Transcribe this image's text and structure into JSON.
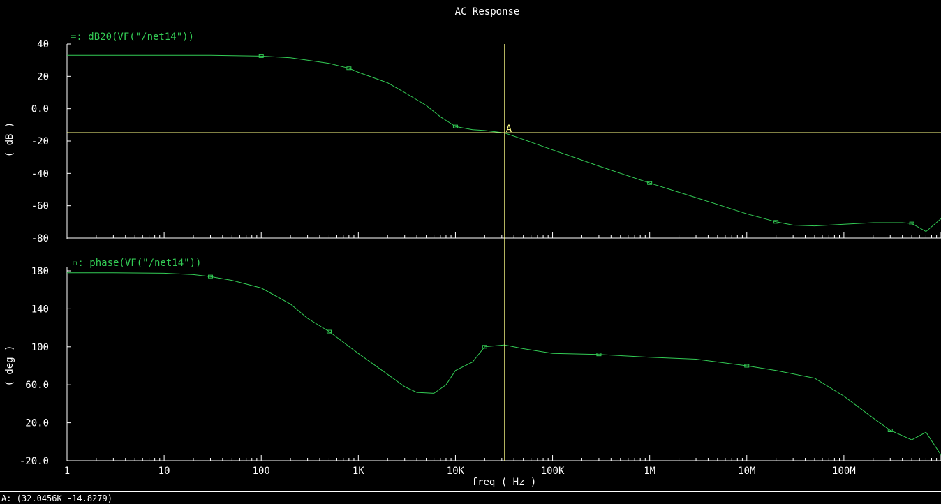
{
  "window": {
    "title": "AC Response"
  },
  "colors": {
    "background": "#000000",
    "trace": "#33cc55",
    "marker": "#ffff88",
    "text": "#ffffff",
    "axis": "#ffffff"
  },
  "status": {
    "text": "A: (32.0456K -14.8279)"
  },
  "marker": {
    "label": "A",
    "x": 32045.6,
    "y": -14.8279
  },
  "chart_data": [
    {
      "type": "line",
      "legend": "=: dB20(VF(\"/net14\"))",
      "ylabel": "( dB )",
      "xscale": "log",
      "xlim": [
        1,
        1000000000
      ],
      "ylim": [
        -80,
        40
      ],
      "yticks": [
        40,
        20,
        0,
        -20,
        -40,
        -60,
        -80
      ],
      "ytick_labels": [
        "40",
        "20",
        "0.0",
        "-20",
        "-40",
        "-60",
        "-80"
      ],
      "series": [
        {
          "x": [
            1,
            3,
            10,
            30,
            100,
            200,
            300,
            500,
            800,
            1000,
            2000,
            3000,
            5000,
            7000,
            10000,
            15000,
            20000,
            32000,
            50000,
            100000,
            300000,
            1000000,
            3000000,
            10000000,
            20000000,
            30000000,
            50000000,
            100000000,
            200000000,
            300000000,
            400000000,
            500000000,
            700000000,
            1000000000
          ],
          "y": [
            33,
            33,
            33,
            33,
            32.5,
            31.5,
            30,
            28,
            25,
            22.5,
            16,
            10,
            2,
            -5,
            -11,
            -13,
            -13.5,
            -15,
            -19,
            -25.5,
            -35.5,
            -46,
            -55,
            -65,
            -70,
            -72,
            -72.5,
            -71.5,
            -70.5,
            -70.5,
            -70.5,
            -71,
            -76,
            -68
          ]
        }
      ]
    },
    {
      "type": "line",
      "legend": "▫: phase(VF(\"/net14\"))",
      "ylabel": "( deg )",
      "xlabel": "freq ( Hz )",
      "xscale": "log",
      "xlim": [
        1,
        1000000000
      ],
      "ylim": [
        -20,
        180
      ],
      "yticks": [
        180,
        140,
        100,
        60,
        20,
        -20
      ],
      "ytick_labels": [
        "180",
        "140",
        "100",
        "60.0",
        "20.0",
        "-20.0"
      ],
      "xtick_labels": [
        "1",
        "10",
        "100",
        "1K",
        "10K",
        "100K",
        "1M",
        "10M",
        "100M"
      ],
      "series": [
        {
          "x": [
            1,
            3,
            10,
            20,
            30,
            50,
            100,
            200,
            300,
            500,
            1000,
            2000,
            3000,
            4000,
            6000,
            8000,
            10000,
            15000,
            20000,
            32000,
            50000,
            100000,
            300000,
            1000000,
            3000000,
            10000000,
            20000000,
            50000000,
            100000000,
            200000000,
            300000000,
            500000000,
            700000000,
            1000000000
          ],
          "y": [
            178,
            178,
            177.5,
            176,
            174,
            170,
            162,
            145,
            130,
            116,
            93,
            71,
            58,
            52,
            51,
            60,
            75,
            84,
            100,
            102,
            98,
            93,
            92,
            89,
            87,
            80,
            75,
            67,
            48,
            25,
            12,
            2,
            10,
            -14
          ]
        }
      ]
    }
  ]
}
